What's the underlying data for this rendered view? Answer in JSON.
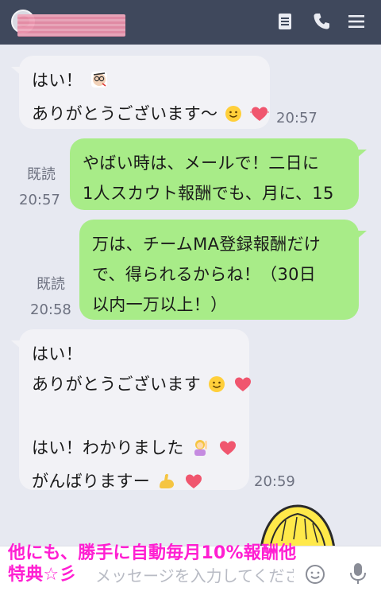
{
  "header": {
    "contact_name": "",
    "icons": {
      "memo": "memo-icon",
      "call": "phone-icon",
      "menu": "menu-icon"
    }
  },
  "messages": [
    {
      "side": "in",
      "lines": [
        "はい！",
        "ありがとうございます〜"
      ],
      "time": "20:57"
    },
    {
      "side": "out",
      "lines": [
        "やばい時は、メールで！二日に",
        "1人スカウト報酬でも、月に、15"
      ],
      "read": "既読",
      "time": "20:57"
    },
    {
      "side": "out",
      "lines": [
        "万は、チームMA登録報酬だけ",
        "で、得られるからね！（30日",
        "以内一万以上！）"
      ],
      "read": "既読",
      "time": "20:58"
    },
    {
      "side": "in",
      "lines": [
        "はい！",
        "ありがとうございます",
        "",
        "はい！わかりました",
        "がんばりますー"
      ],
      "time": "20:59"
    }
  ],
  "input": {
    "placeholder": "メッセージを入力してください。"
  },
  "overlay": {
    "line1": "他にも、勝手に自動毎月10%報酬他",
    "line2": "特典☆彡"
  },
  "colors": {
    "header_bg": "#3f485c",
    "chat_bg": "#e7e9f1",
    "out_bubble": "#a8ec88",
    "in_bubble": "#f2f2f6",
    "overlay_text": "#ff1fd2"
  }
}
